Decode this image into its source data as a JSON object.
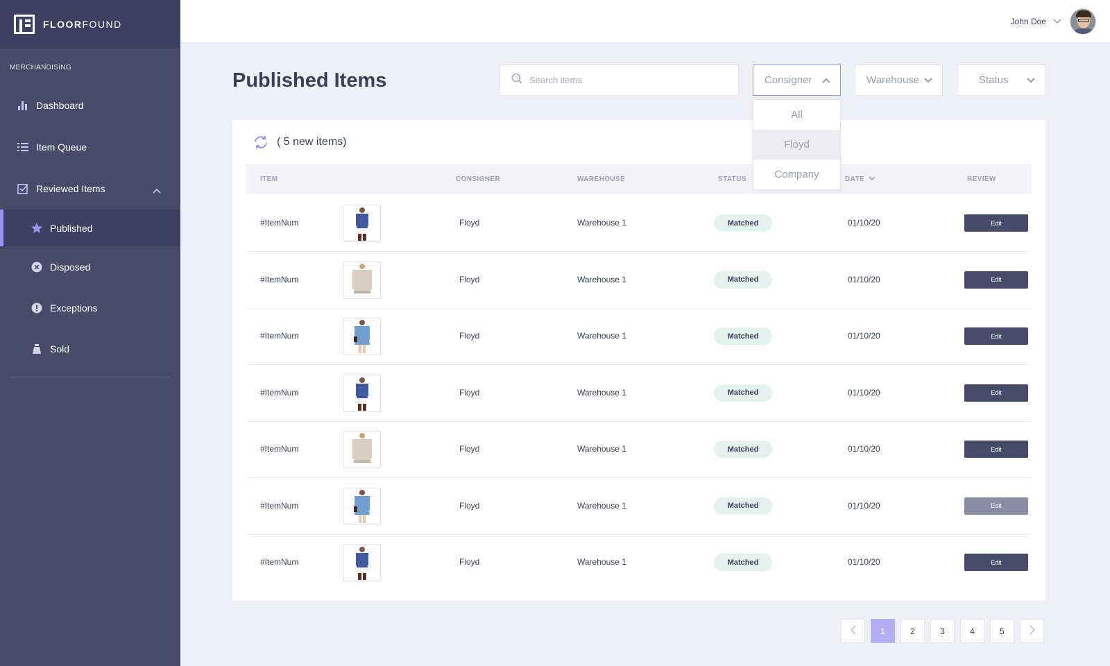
{
  "brand": {
    "name_bold": "FLOOR",
    "name_light": "FOUND"
  },
  "sidebar": {
    "section_label": "MERCHANDISING",
    "items": [
      {
        "label": "Dashboard",
        "icon": "bar-chart-icon"
      },
      {
        "label": "Item Queue",
        "icon": "list-icon"
      },
      {
        "label": "Reviewed Items",
        "icon": "checkbox-icon",
        "expanded": true
      }
    ],
    "sub_items": [
      {
        "label": "Published",
        "icon": "star-icon",
        "active": true
      },
      {
        "label": "Disposed",
        "icon": "x-circle-icon"
      },
      {
        "label": "Exceptions",
        "icon": "exclamation-circle-icon"
      },
      {
        "label": "Sold",
        "icon": "bag-icon"
      }
    ]
  },
  "header": {
    "user_name": "John Doe"
  },
  "page": {
    "title": "Published Items"
  },
  "search": {
    "placeholder": "Search items",
    "value": ""
  },
  "filters": {
    "consigner": {
      "label": "Consigner",
      "open": true,
      "options": [
        "All",
        "Floyd",
        "Company"
      ],
      "highlighted": "Floyd"
    },
    "warehouse": {
      "label": "Warehouse"
    },
    "status": {
      "label": "Status"
    }
  },
  "table": {
    "new_items_text": "( 5 new items)",
    "columns": {
      "item": "ITEM",
      "consigner": "CONSIGNER",
      "warehouse": "WAREHOUSE",
      "status": "STATUS",
      "date": "DATE",
      "review": "REVIEW"
    },
    "rows": [
      {
        "item": "#ItemNum",
        "image": "denim-dress",
        "consigner": "Floyd",
        "warehouse": "Warehouse 1",
        "status": "Matched",
        "date": "01/10/20",
        "action": "Edit"
      },
      {
        "item": "#ItemNum",
        "image": "beige-sweater",
        "consigner": "Floyd",
        "warehouse": "Warehouse 1",
        "status": "Matched",
        "date": "01/10/20",
        "action": "Edit"
      },
      {
        "item": "#ItemNum",
        "image": "light-denim-dress",
        "consigner": "Floyd",
        "warehouse": "Warehouse 1",
        "status": "Matched",
        "date": "01/10/20",
        "action": "Edit"
      },
      {
        "item": "#ItemNum",
        "image": "denim-dress",
        "consigner": "Floyd",
        "warehouse": "Warehouse 1",
        "status": "Matched",
        "date": "01/10/20",
        "action": "Edit"
      },
      {
        "item": "#ItemNum",
        "image": "beige-sweater",
        "consigner": "Floyd",
        "warehouse": "Warehouse 1",
        "status": "Matched",
        "date": "01/10/20",
        "action": "Edit"
      },
      {
        "item": "#ItemNum",
        "image": "light-denim-dress",
        "consigner": "Floyd",
        "warehouse": "Warehouse 1",
        "status": "Matched",
        "date": "01/10/20",
        "action": "Edit",
        "dimmed": true
      },
      {
        "item": "#ItemNum",
        "image": "denim-dress",
        "consigner": "Floyd",
        "warehouse": "Warehouse 1",
        "status": "Matched",
        "date": "01/10/20",
        "action": "Edit"
      }
    ]
  },
  "pagination": {
    "pages": [
      "1",
      "2",
      "3",
      "4",
      "5"
    ],
    "current": "1"
  },
  "colors": {
    "accent": "#9a94f0",
    "sidebar": "#474a69",
    "badge": "#e4f2ee"
  }
}
